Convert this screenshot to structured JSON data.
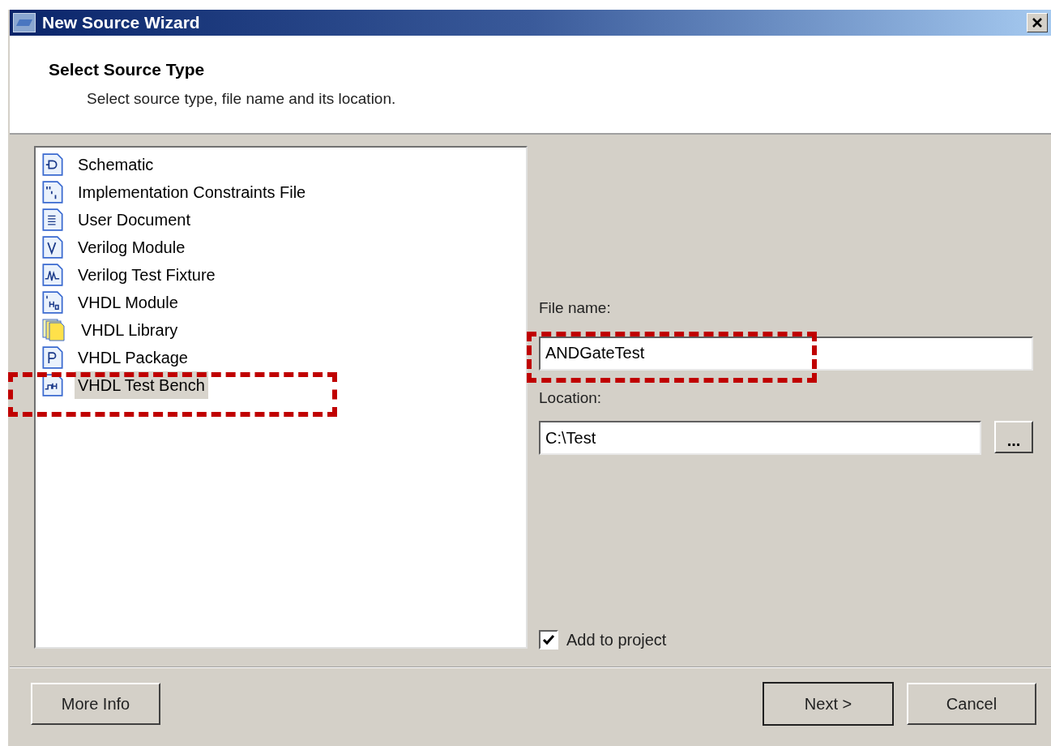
{
  "window": {
    "title": "New Source Wizard"
  },
  "header": {
    "title": "Select Source Type",
    "subtitle": "Select source type, file name and its location."
  },
  "source_types": [
    {
      "label": "Schematic",
      "kind": "schematic",
      "selected": false
    },
    {
      "label": "Implementation Constraints File",
      "kind": "constraints",
      "selected": false
    },
    {
      "label": "User Document",
      "kind": "document",
      "selected": false
    },
    {
      "label": "Verilog Module",
      "kind": "verilog",
      "selected": false
    },
    {
      "label": "Verilog Test Fixture",
      "kind": "fixture",
      "selected": false
    },
    {
      "label": "VHDL Module",
      "kind": "vhdl",
      "selected": false
    },
    {
      "label": "VHDL Library",
      "kind": "library",
      "selected": false
    },
    {
      "label": "VHDL Package",
      "kind": "package",
      "selected": false
    },
    {
      "label": "VHDL Test Bench",
      "kind": "testbench",
      "selected": true
    }
  ],
  "file_name": {
    "label": "File name:",
    "value": "ANDGateTest"
  },
  "location": {
    "label": "Location:",
    "value": "C:\\Test",
    "browse": "..."
  },
  "add_to_project": {
    "label": "Add to project",
    "checked": true
  },
  "buttons": {
    "more_info": "More Info",
    "next": "Next >",
    "cancel": "Cancel"
  }
}
